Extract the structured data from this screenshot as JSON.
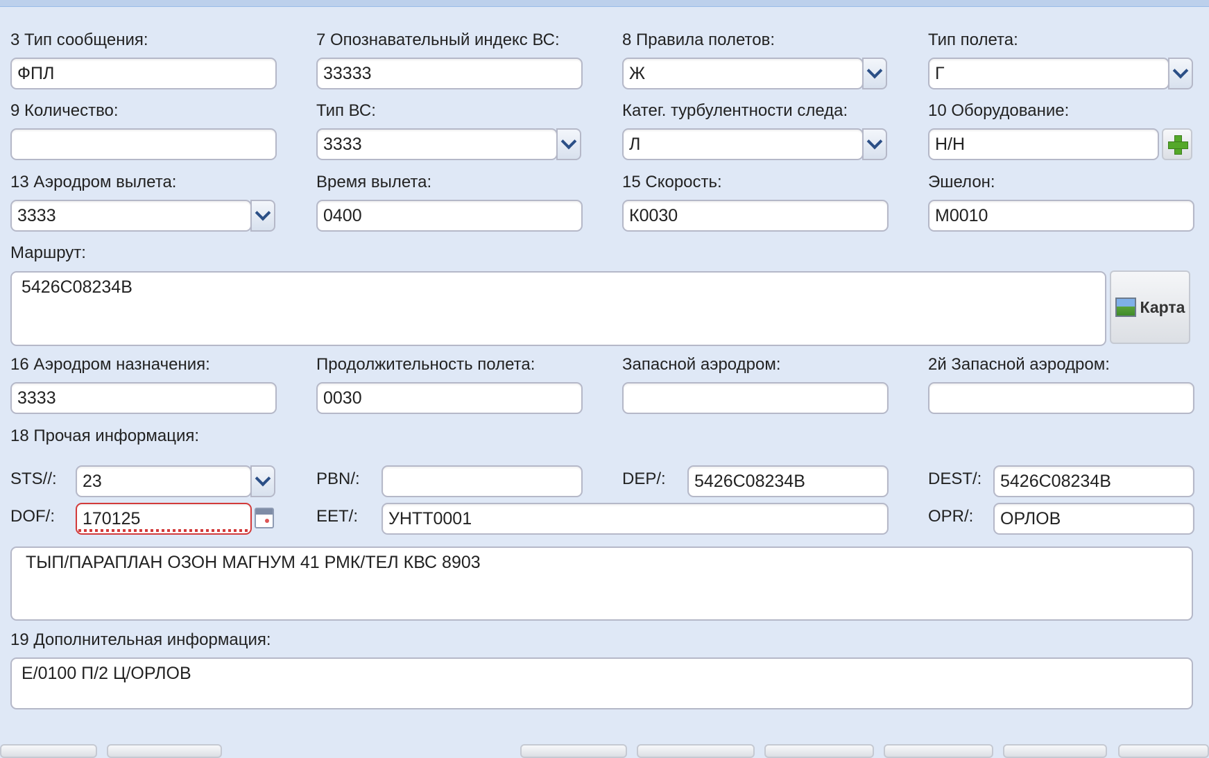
{
  "form": {
    "msg_type": {
      "label": "3 Тип сообщения:",
      "value": "ФПЛ"
    },
    "aircraft_id": {
      "label": "7 Опознавательный индекс ВС:",
      "value": "33333"
    },
    "flight_rules": {
      "label": "8 Правила полетов:",
      "value": "Ж"
    },
    "flight_type": {
      "label": "Тип полета:",
      "value": "Г"
    },
    "quantity": {
      "label": "9 Количество:",
      "value": ""
    },
    "aircraft_type": {
      "label": "Тип ВС:",
      "value": "3333"
    },
    "wake_turbulence": {
      "label": "Катег. турбулентности следа:",
      "value": "Л"
    },
    "equipment": {
      "label": "10 Оборудование:",
      "value": "Н/Н"
    },
    "departure_aerodrome": {
      "label": "13 Аэродром вылета:",
      "value": "3333"
    },
    "departure_time": {
      "label": "Время вылета:",
      "value": "0400"
    },
    "speed": {
      "label": "15 Скорость:",
      "value": "К0030"
    },
    "level": {
      "label": "Эшелон:",
      "value": "М0010"
    },
    "route": {
      "label": "Маршрут:",
      "value": "5426С08234В",
      "map_button": "Карта"
    },
    "destination": {
      "label": "16 Аэродром назначения:",
      "value": "3333"
    },
    "duration": {
      "label": "Продолжительность полета:",
      "value": "0030"
    },
    "alternate": {
      "label": "Запасной аэродром:",
      "value": ""
    },
    "alternate2": {
      "label": "2й Запасной аэродром:",
      "value": ""
    },
    "other_info": {
      "label": "18 Прочая информация:",
      "sts": {
        "label": "STS//:",
        "value": "23"
      },
      "pbn": {
        "label": "PBN/:",
        "value": ""
      },
      "dep": {
        "label": "DEP/:",
        "value": "5426С08234В"
      },
      "dest": {
        "label": "DEST/:",
        "value": "5426С08234В"
      },
      "dof": {
        "label": "DOF/:",
        "value": "170125"
      },
      "eet": {
        "label": "EET/:",
        "value": "УНТТ0001"
      },
      "opr": {
        "label": "OPR/:",
        "value": "ОРЛОВ"
      },
      "text": "ТЫП/ПАРАПЛАН ОЗОН МАГНУМ 41 РМК/ТЕЛ КВС 8903"
    },
    "supplementary": {
      "label": "19 Дополнительная информация:",
      "value": "Е/0100 П/2 Ц/ОРЛОВ"
    }
  },
  "colors": {
    "background": "#dfe8f6",
    "field_border": "#b5b8c8",
    "error": "#d23a3a",
    "trigger_arrow": "#2b4f86"
  }
}
